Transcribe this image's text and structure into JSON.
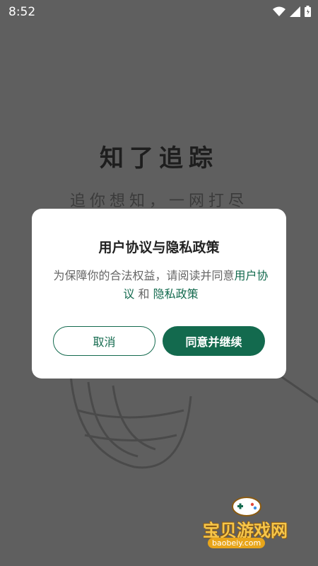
{
  "status_bar": {
    "time": "8:52",
    "icons": [
      "wifi-icon",
      "signal-icon",
      "battery-icon"
    ]
  },
  "splash": {
    "title": "知了追踪",
    "slogan": "追你想知，一网打尽"
  },
  "dialog": {
    "title": "用户协议与隐私政策",
    "message_prefix": "为保障你的合法权益，请阅读并同意",
    "link_user_agreement": "用户协议",
    "connector": "和",
    "link_privacy_policy": "隐私政策",
    "cancel_label": "取消",
    "agree_label": "同意并继续"
  },
  "watermark": {
    "text": "宝贝游戏网",
    "url": "baobeiy.com"
  },
  "colors": {
    "overlay_background": "#5f5f5f",
    "accent_green": "#136a4e",
    "dialog_background": "#ffffff"
  }
}
